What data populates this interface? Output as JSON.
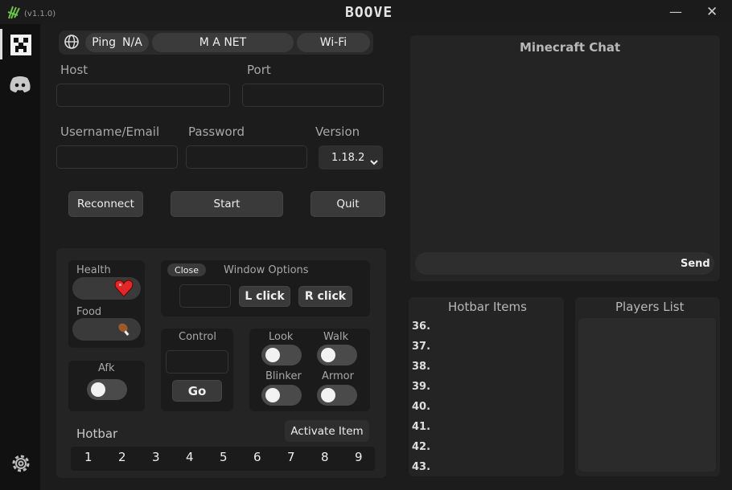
{
  "app": {
    "title": "BOOVE",
    "version": "(v1.1.0)"
  },
  "window_controls": {
    "minimize": "—",
    "close": "✕"
  },
  "topbar": {
    "ping_label": "Ping",
    "ping_value": "N/A",
    "network_name": "M A NET",
    "network_type": "Wi-Fi"
  },
  "connection": {
    "host_label": "Host",
    "host_value": "",
    "port_label": "Port",
    "port_value": "",
    "username_label": "Username/Email",
    "username_value": "",
    "password_label": "Password",
    "password_value": "",
    "version_label": "Version",
    "version_value": "1.18.2"
  },
  "actions": {
    "reconnect": "Reconnect",
    "start": "Start",
    "quit": "Quit"
  },
  "status": {
    "health_label": "Health",
    "food_label": "Food"
  },
  "window_options": {
    "close": "Close",
    "title": "Window Options",
    "left_click": "L click",
    "right_click": "R click"
  },
  "control": {
    "title": "Control",
    "go": "Go"
  },
  "toggles": {
    "afk": "Afk",
    "look": "Look",
    "walk": "Walk",
    "blinker": "Blinker",
    "armor": "Armor"
  },
  "hotbar": {
    "title": "Hotbar",
    "activate": "Activate Item",
    "slots": [
      "1",
      "2",
      "3",
      "4",
      "5",
      "6",
      "7",
      "8",
      "9"
    ]
  },
  "chat": {
    "title": "Minecraft Chat",
    "input_value": "",
    "send": "Send"
  },
  "hotbar_items": {
    "title": "Hotbar Items",
    "slots": [
      "36.",
      "37.",
      "38.",
      "39.",
      "40.",
      "41.",
      "42.",
      "43."
    ]
  },
  "players": {
    "title": "Players List"
  },
  "colors": {
    "accent_green": "#6cc24a",
    "heart": "#e02828"
  }
}
